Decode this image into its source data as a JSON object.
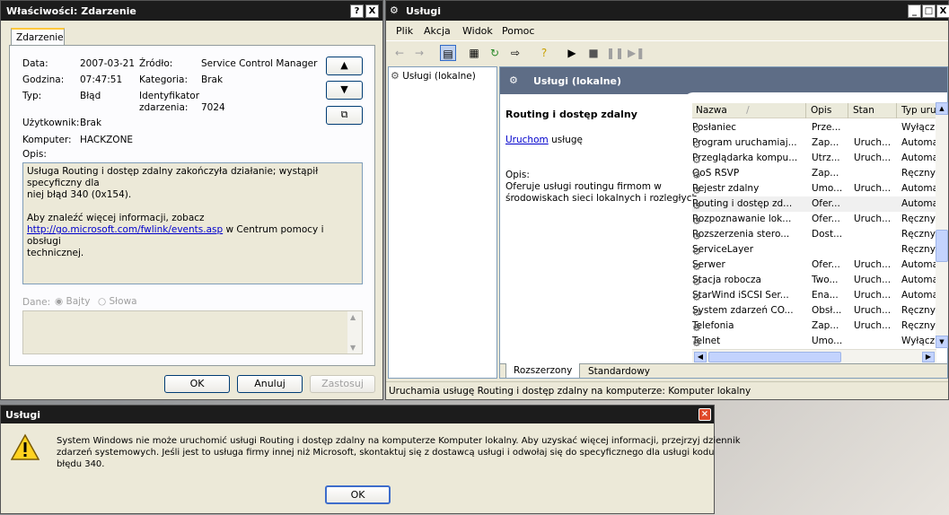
{
  "props": {
    "title": "Właściwości: Zdarzenie",
    "help_btn": "?",
    "close_btn": "X",
    "tab": "Zdarzenie",
    "date_label": "Data:",
    "date_value": "2007-03-21",
    "source_label": "Źródło:",
    "source_value": "Service Control Manager",
    "time_label": "Godzina:",
    "time_value": "07:47:51",
    "category_label": "Kategoria:",
    "category_value": "Brak",
    "type_label": "Typ:",
    "type_value": "Błąd",
    "eventid_label_1": "Identyfikator",
    "eventid_label_2": "zdarzenia:",
    "eventid_value": "7024",
    "user_label": "Użytkownik:",
    "user_value": "Brak",
    "computer_label": "Komputer:",
    "computer_value": "HACKZONE",
    "desc_label": "Opis:",
    "desc_line1": "Usługa Routing i dostęp zdalny zakończyła działanie; wystąpił specyficzny dla",
    "desc_line2": "niej błąd 340 (0x154).",
    "desc_line3": "Aby znaleźć więcej informacji, zobacz",
    "desc_link": "http://go.microsoft.com/fwlink/events.asp",
    "desc_line4": " w Centrum pomocy i obsługi",
    "desc_line5": "technicznej.",
    "data_label": "Dane:",
    "radio_bytes": "Bajty",
    "radio_words": "Słowa",
    "ok": "OK",
    "cancel": "Anuluj",
    "apply": "Zastosuj"
  },
  "services": {
    "title": "Usługi",
    "menu": [
      "Plik",
      "Akcja",
      "Widok",
      "Pomoc"
    ],
    "tree_item": "Usługi (lokalne)",
    "header_title": "Usługi (lokalne)",
    "selected_name": "Routing i dostęp zdalny",
    "start_link": "Uruchom",
    "start_suffix": " usługę",
    "desc_label": "Opis:",
    "desc_text_1": "Oferuje usługi routingu firmom w",
    "desc_text_2": "środowiskach sieci lokalnych i rozległych.",
    "columns": [
      "Nazwa",
      "Opis",
      "Stan",
      "Typ uru"
    ],
    "sort_arrow": "/",
    "rows": [
      {
        "name": "Posłaniec",
        "desc": "Prze...",
        "state": "",
        "type": "Wyłącz"
      },
      {
        "name": "Program uruchamiaj...",
        "desc": "Zap...",
        "state": "Uruch...",
        "type": "Automa"
      },
      {
        "name": "Przeglądarka kompu...",
        "desc": "Utrz...",
        "state": "Uruch...",
        "type": "Automa"
      },
      {
        "name": "QoS RSVP",
        "desc": "Zap...",
        "state": "",
        "type": "Ręczny"
      },
      {
        "name": "Rejestr zdalny",
        "desc": "Umo...",
        "state": "Uruch...",
        "type": "Automa"
      },
      {
        "name": "Routing i dostęp zd...",
        "desc": "Ofer...",
        "state": "",
        "type": "Automa"
      },
      {
        "name": "Rozpoznawanie lok...",
        "desc": "Ofer...",
        "state": "Uruch...",
        "type": "Ręczny"
      },
      {
        "name": "Rozszerzenia stero...",
        "desc": "Dost...",
        "state": "",
        "type": "Ręczny"
      },
      {
        "name": "ServiceLayer",
        "desc": "",
        "state": "",
        "type": "Ręczny"
      },
      {
        "name": "Serwer",
        "desc": "Ofer...",
        "state": "Uruch...",
        "type": "Automa"
      },
      {
        "name": "Stacja robocza",
        "desc": "Two...",
        "state": "Uruch...",
        "type": "Automa"
      },
      {
        "name": "StarWind iSCSI Ser...",
        "desc": "Ena...",
        "state": "Uruch...",
        "type": "Automa"
      },
      {
        "name": "System zdarzeń CO...",
        "desc": "Obsł...",
        "state": "Uruch...",
        "type": "Ręczny"
      },
      {
        "name": "Telefonia",
        "desc": "Zap...",
        "state": "Uruch...",
        "type": "Ręczny"
      },
      {
        "name": "Telnet",
        "desc": "Umo...",
        "state": "",
        "type": "Wyłącz"
      }
    ],
    "tab_extended": "Rozszerzony",
    "tab_standard": "Standardowy",
    "status": "Uruchamia usługę Routing i dostęp zdalny na komputerze: Komputer lokalny"
  },
  "alert": {
    "title": "Usługi",
    "message_1": "System Windows nie może uruchomić usługi Routing i dostęp zdalny na komputerze Komputer lokalny. Aby uzyskać więcej informacji, przejrzyj dziennik",
    "message_2": "zdarzeń systemowych. Jeśli jest to usługa firmy innej niż Microsoft, skontaktuj się z dostawcą usługi i odwołaj się do specyficznego dla usługi kodu",
    "message_3": "błędu 340.",
    "ok": "OK"
  }
}
